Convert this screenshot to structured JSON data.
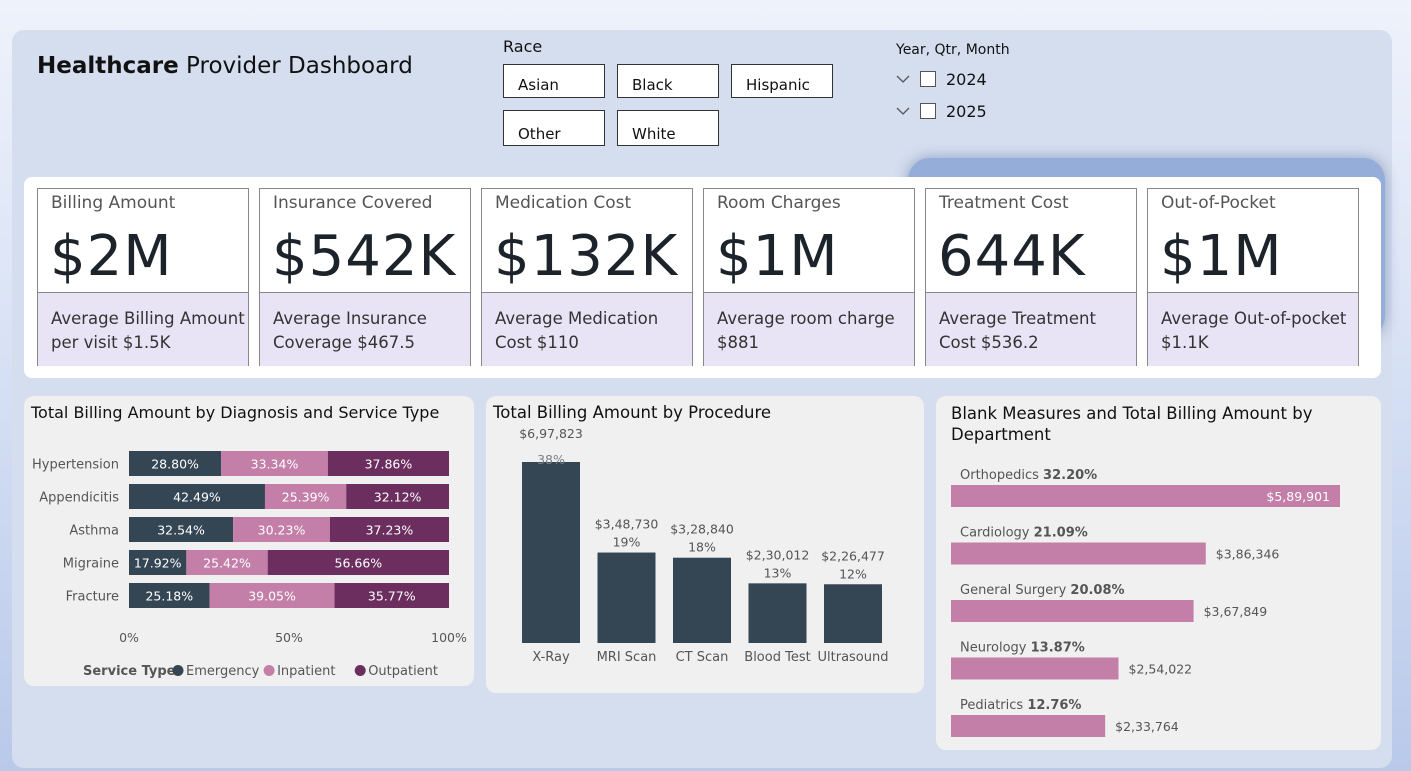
{
  "title": {
    "bold": "Healthcare",
    "rest": " Provider Dashboard"
  },
  "race": {
    "label": "Race",
    "options": [
      "Asian",
      "Black",
      "Hispanic",
      "Other",
      "White"
    ]
  },
  "year_slicer": {
    "label": "Year, Qtr, Month",
    "years": [
      "2024",
      "2025"
    ]
  },
  "kpis": [
    {
      "label": "Billing Amount",
      "value": "$2M",
      "sub": "Average Billing Amount per visit $1.5K"
    },
    {
      "label": "Insurance Covered",
      "value": "$542K",
      "sub": "Average Insurance Coverage $467.5"
    },
    {
      "label": "Medication Cost",
      "value": "$132K",
      "sub": "Average Medication Cost $110"
    },
    {
      "label": "Room Charges",
      "value": "$1M",
      "sub": "Average room charge $881"
    },
    {
      "label": "Treatment Cost",
      "value": "644K",
      "sub": "Average Treatment Cost $536.2"
    },
    {
      "label": "Out-of-Pocket",
      "value": "$1M",
      "sub": "Average Out-of-pocket $1.1K"
    }
  ],
  "colors": {
    "emergency": "#344654",
    "inpatient": "#c47fa8",
    "outpatient": "#6b2e5f",
    "dept_bar": "#c47fa8",
    "proc_bar": "#344654"
  },
  "chart_data": [
    {
      "type": "bar",
      "orientation": "horizontal-stacked-100",
      "title": "Total Billing Amount by Diagnosis and Service Type",
      "categories": [
        "Hypertension",
        "Appendicitis",
        "Asthma",
        "Migraine",
        "Fracture"
      ],
      "series": [
        {
          "name": "Emergency",
          "values": [
            28.8,
            42.49,
            32.54,
            17.92,
            25.18
          ],
          "labels": [
            "28.80%",
            "42.49%",
            "32.54%",
            "17.92%",
            "25.18%"
          ]
        },
        {
          "name": "Inpatient",
          "values": [
            33.34,
            25.39,
            30.23,
            25.42,
            39.05
          ],
          "labels": [
            "33.34%",
            "25.39%",
            "30.23%",
            "25.42%",
            "39.05%"
          ]
        },
        {
          "name": "Outpatient",
          "values": [
            37.86,
            32.12,
            37.23,
            56.66,
            35.77
          ],
          "labels": [
            "37.86%",
            "32.12%",
            "37.23%",
            "56.66%",
            "35.77%"
          ]
        }
      ],
      "x_ticks": [
        "0%",
        "50%",
        "100%"
      ],
      "legend_title": "Service Type",
      "legend_position": "bottom"
    },
    {
      "type": "bar",
      "title": "Total Billing Amount by Procedure",
      "categories": [
        "X-Ray",
        "MRI Scan",
        "CT Scan",
        "Blood Test",
        "Ultrasound"
      ],
      "values": [
        697823,
        348730,
        328840,
        230012,
        226477
      ],
      "value_labels": [
        "$6,97,823",
        "$3,48,730",
        "$3,28,840",
        "$2,30,012",
        "$2,26,477"
      ],
      "pct_labels": [
        "38%",
        "19%",
        "18%",
        "13%",
        "12%"
      ]
    },
    {
      "type": "bar",
      "orientation": "horizontal",
      "title": "Blank Measures and Total Billing Amount by Department",
      "categories": [
        "Orthopedics",
        "Cardiology",
        "General Surgery",
        "Neurology",
        "Pediatrics"
      ],
      "pcts": [
        "32.20%",
        "21.09%",
        "20.08%",
        "13.87%",
        "12.76%"
      ],
      "values": [
        589901,
        386346,
        367849,
        254022,
        233764
      ],
      "value_labels": [
        "$5,89,901",
        "$3,86,346",
        "$3,67,849",
        "$2,54,022",
        "$2,33,764"
      ]
    }
  ]
}
